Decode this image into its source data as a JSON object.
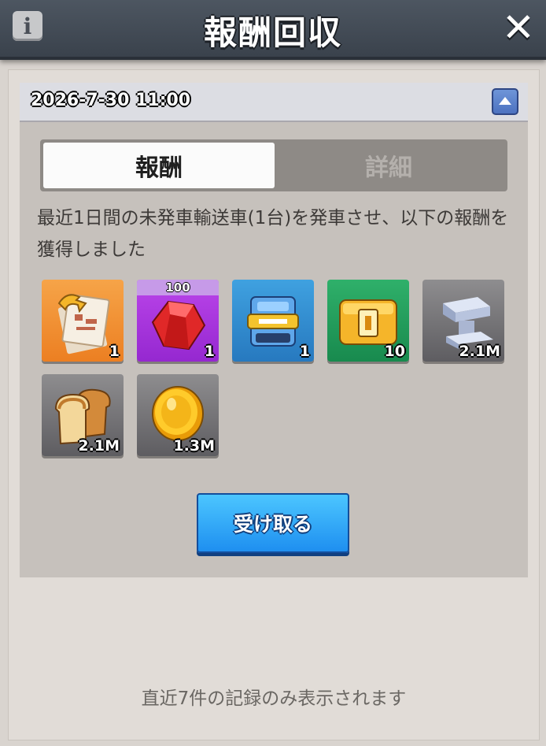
{
  "header": {
    "title": "報酬回収",
    "info_icon": "i"
  },
  "record": {
    "date": "2026-7-30 11:00",
    "tabs": [
      {
        "label": "報酬",
        "active": true
      },
      {
        "label": "詳細",
        "active": false
      }
    ],
    "description": "最近1日間の未発車輸送車(1台)を発車させ、以下の報酬を獲得しました",
    "rewards": [
      {
        "icon": "blueprint-scroll-icon",
        "quantity": "1",
        "badge": ""
      },
      {
        "icon": "red-gem-icon",
        "quantity": "1",
        "badge": "100"
      },
      {
        "icon": "blue-chest-icon",
        "quantity": "1",
        "badge": ""
      },
      {
        "icon": "gold-chest-icon",
        "quantity": "10",
        "badge": ""
      },
      {
        "icon": "iron-ingot-icon",
        "quantity": "2.1M",
        "badge": ""
      },
      {
        "icon": "bread-icon",
        "quantity": "2.1M",
        "badge": ""
      },
      {
        "icon": "gold-coin-icon",
        "quantity": "1.3M",
        "badge": ""
      }
    ],
    "claim_label": "受け取る"
  },
  "footer_note": "直近7件の記録のみ表示されます"
}
